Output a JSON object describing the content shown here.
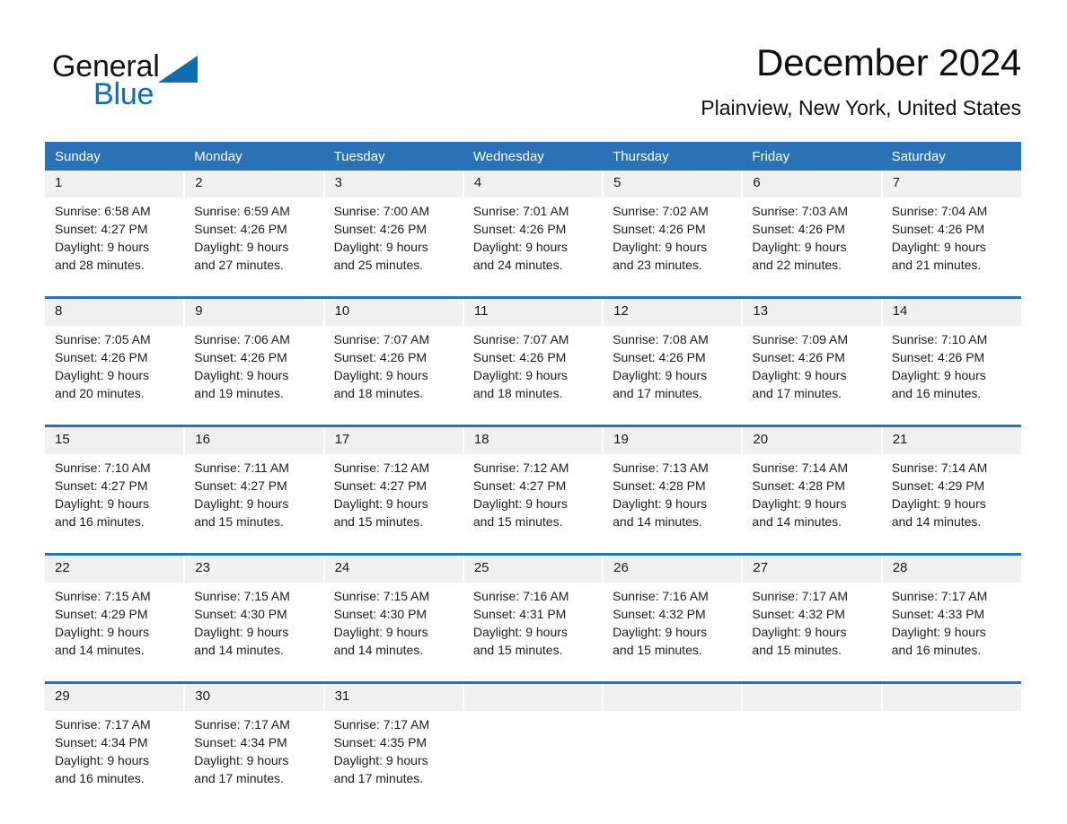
{
  "brand": {
    "name_part1": "General",
    "name_part2": "Blue",
    "triangle_color": "#0e6cb0",
    "blue_color": "#0a6cbf"
  },
  "header": {
    "month_title": "December 2024",
    "location": "Plainview, New York, United States"
  },
  "theme": {
    "header_blue": "#2a72b5",
    "daynum_band": "#f0f0f0",
    "page_background": "#ffffff"
  },
  "weekday_headers": [
    "Sunday",
    "Monday",
    "Tuesday",
    "Wednesday",
    "Thursday",
    "Friday",
    "Saturday"
  ],
  "weeks": [
    [
      {
        "day": "1",
        "sunrise": "Sunrise: 6:58 AM",
        "sunset": "Sunset: 4:27 PM",
        "daylight_line1": "Daylight: 9 hours",
        "daylight_line2": "and 28 minutes."
      },
      {
        "day": "2",
        "sunrise": "Sunrise: 6:59 AM",
        "sunset": "Sunset: 4:26 PM",
        "daylight_line1": "Daylight: 9 hours",
        "daylight_line2": "and 27 minutes."
      },
      {
        "day": "3",
        "sunrise": "Sunrise: 7:00 AM",
        "sunset": "Sunset: 4:26 PM",
        "daylight_line1": "Daylight: 9 hours",
        "daylight_line2": "and 25 minutes."
      },
      {
        "day": "4",
        "sunrise": "Sunrise: 7:01 AM",
        "sunset": "Sunset: 4:26 PM",
        "daylight_line1": "Daylight: 9 hours",
        "daylight_line2": "and 24 minutes."
      },
      {
        "day": "5",
        "sunrise": "Sunrise: 7:02 AM",
        "sunset": "Sunset: 4:26 PM",
        "daylight_line1": "Daylight: 9 hours",
        "daylight_line2": "and 23 minutes."
      },
      {
        "day": "6",
        "sunrise": "Sunrise: 7:03 AM",
        "sunset": "Sunset: 4:26 PM",
        "daylight_line1": "Daylight: 9 hours",
        "daylight_line2": "and 22 minutes."
      },
      {
        "day": "7",
        "sunrise": "Sunrise: 7:04 AM",
        "sunset": "Sunset: 4:26 PM",
        "daylight_line1": "Daylight: 9 hours",
        "daylight_line2": "and 21 minutes."
      }
    ],
    [
      {
        "day": "8",
        "sunrise": "Sunrise: 7:05 AM",
        "sunset": "Sunset: 4:26 PM",
        "daylight_line1": "Daylight: 9 hours",
        "daylight_line2": "and 20 minutes."
      },
      {
        "day": "9",
        "sunrise": "Sunrise: 7:06 AM",
        "sunset": "Sunset: 4:26 PM",
        "daylight_line1": "Daylight: 9 hours",
        "daylight_line2": "and 19 minutes."
      },
      {
        "day": "10",
        "sunrise": "Sunrise: 7:07 AM",
        "sunset": "Sunset: 4:26 PM",
        "daylight_line1": "Daylight: 9 hours",
        "daylight_line2": "and 18 minutes."
      },
      {
        "day": "11",
        "sunrise": "Sunrise: 7:07 AM",
        "sunset": "Sunset: 4:26 PM",
        "daylight_line1": "Daylight: 9 hours",
        "daylight_line2": "and 18 minutes."
      },
      {
        "day": "12",
        "sunrise": "Sunrise: 7:08 AM",
        "sunset": "Sunset: 4:26 PM",
        "daylight_line1": "Daylight: 9 hours",
        "daylight_line2": "and 17 minutes."
      },
      {
        "day": "13",
        "sunrise": "Sunrise: 7:09 AM",
        "sunset": "Sunset: 4:26 PM",
        "daylight_line1": "Daylight: 9 hours",
        "daylight_line2": "and 17 minutes."
      },
      {
        "day": "14",
        "sunrise": "Sunrise: 7:10 AM",
        "sunset": "Sunset: 4:26 PM",
        "daylight_line1": "Daylight: 9 hours",
        "daylight_line2": "and 16 minutes."
      }
    ],
    [
      {
        "day": "15",
        "sunrise": "Sunrise: 7:10 AM",
        "sunset": "Sunset: 4:27 PM",
        "daylight_line1": "Daylight: 9 hours",
        "daylight_line2": "and 16 minutes."
      },
      {
        "day": "16",
        "sunrise": "Sunrise: 7:11 AM",
        "sunset": "Sunset: 4:27 PM",
        "daylight_line1": "Daylight: 9 hours",
        "daylight_line2": "and 15 minutes."
      },
      {
        "day": "17",
        "sunrise": "Sunrise: 7:12 AM",
        "sunset": "Sunset: 4:27 PM",
        "daylight_line1": "Daylight: 9 hours",
        "daylight_line2": "and 15 minutes."
      },
      {
        "day": "18",
        "sunrise": "Sunrise: 7:12 AM",
        "sunset": "Sunset: 4:27 PM",
        "daylight_line1": "Daylight: 9 hours",
        "daylight_line2": "and 15 minutes."
      },
      {
        "day": "19",
        "sunrise": "Sunrise: 7:13 AM",
        "sunset": "Sunset: 4:28 PM",
        "daylight_line1": "Daylight: 9 hours",
        "daylight_line2": "and 14 minutes."
      },
      {
        "day": "20",
        "sunrise": "Sunrise: 7:14 AM",
        "sunset": "Sunset: 4:28 PM",
        "daylight_line1": "Daylight: 9 hours",
        "daylight_line2": "and 14 minutes."
      },
      {
        "day": "21",
        "sunrise": "Sunrise: 7:14 AM",
        "sunset": "Sunset: 4:29 PM",
        "daylight_line1": "Daylight: 9 hours",
        "daylight_line2": "and 14 minutes."
      }
    ],
    [
      {
        "day": "22",
        "sunrise": "Sunrise: 7:15 AM",
        "sunset": "Sunset: 4:29 PM",
        "daylight_line1": "Daylight: 9 hours",
        "daylight_line2": "and 14 minutes."
      },
      {
        "day": "23",
        "sunrise": "Sunrise: 7:15 AM",
        "sunset": "Sunset: 4:30 PM",
        "daylight_line1": "Daylight: 9 hours",
        "daylight_line2": "and 14 minutes."
      },
      {
        "day": "24",
        "sunrise": "Sunrise: 7:15 AM",
        "sunset": "Sunset: 4:30 PM",
        "daylight_line1": "Daylight: 9 hours",
        "daylight_line2": "and 14 minutes."
      },
      {
        "day": "25",
        "sunrise": "Sunrise: 7:16 AM",
        "sunset": "Sunset: 4:31 PM",
        "daylight_line1": "Daylight: 9 hours",
        "daylight_line2": "and 15 minutes."
      },
      {
        "day": "26",
        "sunrise": "Sunrise: 7:16 AM",
        "sunset": "Sunset: 4:32 PM",
        "daylight_line1": "Daylight: 9 hours",
        "daylight_line2": "and 15 minutes."
      },
      {
        "day": "27",
        "sunrise": "Sunrise: 7:17 AM",
        "sunset": "Sunset: 4:32 PM",
        "daylight_line1": "Daylight: 9 hours",
        "daylight_line2": "and 15 minutes."
      },
      {
        "day": "28",
        "sunrise": "Sunrise: 7:17 AM",
        "sunset": "Sunset: 4:33 PM",
        "daylight_line1": "Daylight: 9 hours",
        "daylight_line2": "and 16 minutes."
      }
    ],
    [
      {
        "day": "29",
        "sunrise": "Sunrise: 7:17 AM",
        "sunset": "Sunset: 4:34 PM",
        "daylight_line1": "Daylight: 9 hours",
        "daylight_line2": "and 16 minutes."
      },
      {
        "day": "30",
        "sunrise": "Sunrise: 7:17 AM",
        "sunset": "Sunset: 4:34 PM",
        "daylight_line1": "Daylight: 9 hours",
        "daylight_line2": "and 17 minutes."
      },
      {
        "day": "31",
        "sunrise": "Sunrise: 7:17 AM",
        "sunset": "Sunset: 4:35 PM",
        "daylight_line1": "Daylight: 9 hours",
        "daylight_line2": "and 17 minutes."
      },
      {
        "day": "",
        "sunrise": "",
        "sunset": "",
        "daylight_line1": "",
        "daylight_line2": ""
      },
      {
        "day": "",
        "sunrise": "",
        "sunset": "",
        "daylight_line1": "",
        "daylight_line2": ""
      },
      {
        "day": "",
        "sunrise": "",
        "sunset": "",
        "daylight_line1": "",
        "daylight_line2": ""
      },
      {
        "day": "",
        "sunrise": "",
        "sunset": "",
        "daylight_line1": "",
        "daylight_line2": ""
      }
    ]
  ]
}
